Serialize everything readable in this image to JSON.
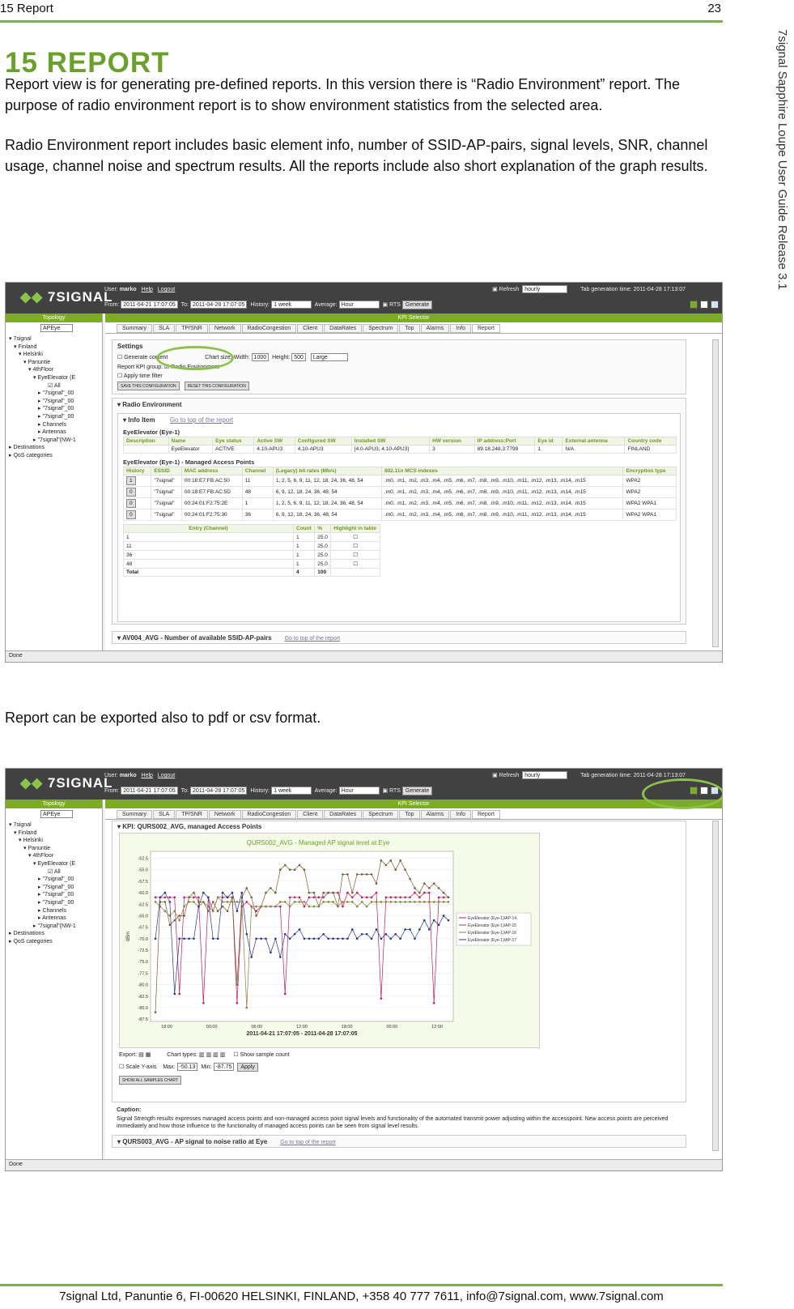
{
  "header": {
    "left": "15 Report",
    "page_number": "23"
  },
  "side_text": "7signal Sapphire Loupe User Guide Release 3.1",
  "section_title": "15 REPORT",
  "paragraphs": [
    "Report view is for generating pre-defined reports. In this version there is “Radio Environment” report. The purpose of radio environment report is to show environment statistics from the selected area.",
    "Radio Environment report includes basic element info, number of SSID-AP-pairs, signal levels, SNR, channel usage, channel noise and spectrum results.  All the reports include also short explanation of the graph results.",
    "Report can be exported also to pdf or csv format."
  ],
  "footer": "7signal Ltd, Panuntie 6, FI-00620 HELSINKI, FINLAND, +358 40 777 7611, info@7signal.com, www.7signal.com",
  "app": {
    "logo_text": "7SIGNAL",
    "user_label": "User:",
    "user": "marko",
    "help": "Help",
    "logout": "Logout",
    "refresh_label": "Refresh",
    "refresh_value": "hourly",
    "tab_gen_label": "Tab generation time: 2011-04-28 17:13:07",
    "from_label": "From:",
    "from_value": "2011-04-21 17:07:05",
    "to_label": "To:",
    "to_value": "2011-04-28 17:07:05",
    "history_label": "History:",
    "history_value": "1 week",
    "average_label": "Average:",
    "average_value": "Hour",
    "rts_label": "RTS",
    "generate": "Generate",
    "topology_title": "Topology",
    "topology_select": "APEye",
    "kpi_selector": "KPI Selector",
    "tabs": [
      "Summary",
      "SLA",
      "TP/SNR",
      "Network",
      "RadioCongestion",
      "Client",
      "DataRates",
      "Spectrum",
      "Top",
      "Alarms",
      "Info",
      "Report"
    ],
    "tree": [
      "7signal",
      "Finland",
      "Helsinki",
      "Panuntie",
      "4thFloor",
      "EyeElevator (E",
      "All",
      "\"7signal\"_00",
      "\"7signal\"_00",
      "\"7signal\"_00",
      "\"7signal\"_00",
      "Channels",
      "Antennas",
      "\"7signal\"(NW-1",
      "Destinations",
      "QoS categories"
    ],
    "status": "Done"
  },
  "shot1": {
    "settings_title": "Settings",
    "gen_content": "Generate content",
    "chart_size": "Chart size:",
    "width_label": "Width:",
    "width_value": "1000",
    "height_label": "Height:",
    "height_value": "500",
    "size_value": "Large",
    "report_group": "Report KPI group:",
    "radio_env_opt": "Radio Environment",
    "apply_time": "Apply time filter",
    "save_btn": "SAVE THIS CONFIGURATION",
    "reset_btn": "RESET THIS CONFIGURATION",
    "radio_env": "Radio Environment",
    "info_item": "Info Item",
    "goto_top": "Go to top of the report",
    "elem_title": "EyeElevator (Eye-1)",
    "info_headers": [
      "Description",
      "Name",
      "Eye status",
      "Active SW",
      "Configured SW",
      "Installed SW",
      "HW version",
      "IP address:Port",
      "Eye id",
      "External antenna",
      "Country code"
    ],
    "info_row": [
      "",
      "EyeElevator",
      "ACTIVE",
      "4.10-APU3",
      "4.10-APU3",
      "[4.0-APU3, 4.10-APU3]",
      "3",
      "89.18.248.3:7799",
      "1",
      "N/A",
      "FINLAND"
    ],
    "map_title": "EyeElevator (Eye-1) - Managed Access Points",
    "map_headers": [
      "History",
      "ESSID",
      "MAC address",
      "Channel",
      "(Legacy) bit rates (Mb/s)",
      "802.11n MCS indexes",
      "Encryption type"
    ],
    "map_rows": [
      [
        "1",
        "\"7signal\"",
        "00:18:E7:FB:AC:50",
        "11",
        "1, 2, 5, 6, 9, 11, 12, 18, 24, 36, 48, 54",
        ".m0, .m1, .m2, .m3, .m4, .m5, .m6, .m7, .m8, .m9, .m10, .m11, .m12, .m13, .m14, .m15",
        "WPA2"
      ],
      [
        "0",
        "\"7signal\"",
        "00:18:E7:FB:AC:5D",
        "48",
        "6, 9, 12, 18, 24, 36, 48, 54",
        ".m0, .m1, .m2, .m3, .m4, .m5, .m6, .m7, .m8, .m9, .m10, .m11, .m12, .m13, .m14, .m15",
        "WPA2"
      ],
      [
        "0",
        "\"7signal\"",
        "00:24:01:F2:75:2E",
        "1",
        "1, 2, 5, 6, 9, 11, 12, 18, 24, 36, 48, 54",
        ".m0, .m1, .m2, .m3, .m4, .m5, .m6, .m7, .m8, .m9, .m10, .m11, .m12, .m13, .m14, .m15",
        "WPA2 WPA1"
      ],
      [
        "0",
        "\"7signal\"",
        "00:24:01:F2:75:30",
        "36",
        "6, 9, 12, 18, 24, 36, 48, 54",
        ".m0, .m1, .m2, .m3, .m4, .m5, .m6, .m7, .m8, .m9, .m10, .m11, .m12, .m13, .m14, .m15",
        "WPA2 WPA1"
      ]
    ],
    "ch_headers": [
      "Entry (Channel)",
      "Count",
      "%",
      "Highlight in table"
    ],
    "ch_rows": [
      [
        "1",
        "1",
        "25.0"
      ],
      [
        "11",
        "1",
        "25.0"
      ],
      [
        "36",
        "1",
        "25.0"
      ],
      [
        "48",
        "1",
        "25.0"
      ]
    ],
    "total_row": [
      "Total",
      "4",
      "100"
    ],
    "av004": "AV004_AVG - Number of available SSID-AP-pairs"
  },
  "shot2": {
    "kpi_title": "KPI: QURS002_AVG, managed Access Points",
    "export_label": "Export:",
    "chart_types": "Chart types:",
    "show_sample": "Show sample count",
    "scale_y": "Scale Y-axis",
    "max_label": "Max:",
    "max_value": "-50.13",
    "min_label": "Min:",
    "min_value": "-87.75",
    "apply": "Apply",
    "show_all": "SHOW ALL SAMPLES CHART",
    "caption_title": "Caption:",
    "caption": "Signal Strength results expresses managed access points and non-managed access point signal levels and functionality of the automated transmit power adjusting within the accesspoint. New access points are perceived immediately and how those influence to the functionality of managed access points can be seen from signal level results.",
    "qurs003": "QURS003_AVG - AP signal to noise ratio at Eye",
    "goto_top": "Go to top of the report"
  },
  "chart_data": {
    "type": "line",
    "title": "QURS002_AVG - Managed AP signal level at Eye",
    "xlabel": "2011-04-21 17:07:05 - 2011-04-28 17:07:05",
    "ylabel": "dBm",
    "ylim": [
      -88,
      -51
    ],
    "yticks": [
      -52.5,
      -55.0,
      -57.5,
      -60.0,
      -62.5,
      -65.0,
      -67.5,
      -70.0,
      -72.5,
      -75.0,
      -77.5,
      -80.0,
      -82.5,
      -85.0,
      -87.5
    ],
    "xticks": [
      "18:00",
      "00:00",
      "06:00",
      "12:00",
      "18:00",
      "00:00",
      "12:00"
    ],
    "series": [
      {
        "name": "EyeElevator (Eye-1)/AP-14",
        "color": "#c2185b",
        "values": [
          -61,
          -61,
          -61,
          -61,
          -61,
          -82,
          -61,
          -61,
          -61,
          -61,
          -84,
          -61,
          -64,
          -61,
          -61,
          -61,
          -61,
          -84,
          -63,
          -62,
          -63,
          -64,
          -63,
          -63,
          -63,
          -63,
          -63,
          -82,
          -61,
          -61,
          -61,
          -63,
          -61,
          -61,
          -61,
          -61,
          -60,
          -60,
          -60,
          -63,
          -60,
          -61,
          -60,
          -61,
          -61,
          -61,
          -60,
          -83,
          -61,
          -61,
          -61,
          -61,
          -61,
          -61,
          -60,
          -61,
          -60,
          -60,
          -84,
          -61,
          -61,
          -61
        ]
      },
      {
        "name": "EyeElevator (Eye-1)/AP-15",
        "color": "#7a5c2e",
        "values": [
          -86,
          -62,
          -62,
          -67,
          -66,
          -65,
          -65,
          -61,
          -60,
          -62,
          -62,
          -64,
          -62,
          -64,
          -63,
          -64,
          -61,
          -80,
          -61,
          -59,
          -61,
          -65,
          -63,
          -60,
          -59,
          -60,
          -55,
          -54,
          -55,
          -55,
          -54,
          -55,
          -60,
          -60,
          -63,
          -60,
          -60,
          -60,
          -63,
          -56,
          -56,
          -60,
          -56,
          -56,
          -56,
          -56,
          -58,
          -53,
          -54,
          -53,
          -55,
          -53,
          -55,
          -57,
          -59,
          -60,
          -58,
          -59,
          -58,
          -59,
          -60,
          -61
        ]
      },
      {
        "name": "EyeElevator (Eye-1)/AP-16",
        "color": "#8b7d3c",
        "values": [
          -62,
          -63,
          -64,
          -65,
          -64,
          -66,
          -63,
          -62,
          -62,
          -63,
          -62,
          -63,
          -64,
          -61,
          -62,
          -62,
          -62,
          -62,
          -62,
          -85,
          -63,
          -63,
          -63,
          -63,
          -63,
          -63,
          -62,
          -62,
          -63,
          -62,
          -62,
          -62,
          -63,
          -63,
          -63,
          -62,
          -62,
          -62,
          -63,
          -62,
          -62,
          -62,
          -63,
          -62,
          -63,
          -62,
          -62,
          -62,
          -62,
          -62,
          -62,
          -62,
          -62,
          -62,
          -62,
          -62,
          -62,
          -62,
          -62,
          -62,
          -62,
          -62
        ]
      },
      {
        "name": "EyeElevator (Eye-1)/AP-17",
        "color": "#283593",
        "values": [
          -70,
          -61,
          -60,
          -62,
          -82,
          -70,
          -70,
          -70,
          -70,
          -63,
          -60,
          -61,
          -70,
          -70,
          -60,
          -61,
          -60,
          -64,
          -60,
          -69,
          -74,
          -70,
          -70,
          -70,
          -73,
          -70,
          -74,
          -69,
          -70,
          -69,
          -68,
          -70,
          -70,
          -70,
          -70,
          -69,
          -70,
          -70,
          -70,
          -70,
          -70,
          -68,
          -70,
          -69,
          -69,
          -70,
          -68,
          -70,
          -69,
          -70,
          -69,
          -70,
          -68,
          -68,
          -70,
          -68,
          -66,
          -68,
          -66,
          -67,
          -65,
          -66
        ]
      }
    ]
  }
}
